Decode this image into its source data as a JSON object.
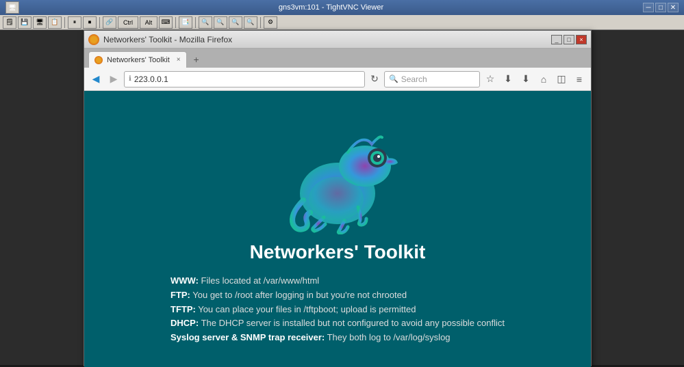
{
  "vnc": {
    "title": "gns3vm:101 - TightVNC Viewer",
    "toolbar_buttons": [
      "📁",
      "💾",
      "🖥",
      "📋",
      "⏸",
      "⏹",
      "🔗",
      "Ctrl",
      "Alt",
      "⌨",
      "📑",
      "🔍",
      "🔍",
      "🔍",
      "🔍",
      "⚙"
    ]
  },
  "firefox": {
    "title": "Networkers' Toolkit - Mozilla Firefox",
    "tab_label": "Networkers' Toolkit",
    "tab_close": "×",
    "tab_new": "+",
    "url": "223.0.0.1",
    "search_placeholder": "Search",
    "win_btn_min": "_",
    "win_btn_max": "□",
    "win_btn_close": "×"
  },
  "page": {
    "title": "Networkers' Toolkit",
    "info_lines": [
      {
        "label": "WWW:",
        "text": " Files located at /var/www/html"
      },
      {
        "label": "FTP:",
        "text": " You get to /root after logging in but you're not chrooted"
      },
      {
        "label": "TFTP:",
        "text": " You can place your files in /tftpboot; upload is permitted"
      },
      {
        "label": "DHCP:",
        "text": " The DHCP server is installed but not configured to avoid any possible conflict"
      },
      {
        "label": "Syslog server & SNMP trap receiver:",
        "text": " They both log to /var/log/syslog"
      }
    ]
  }
}
